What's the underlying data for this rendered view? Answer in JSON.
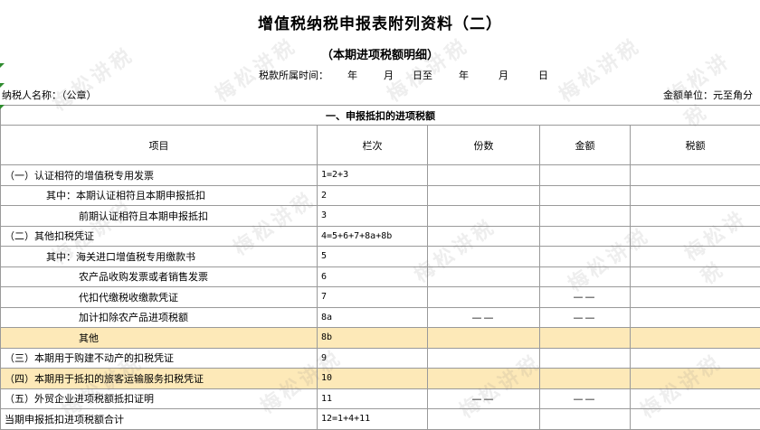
{
  "title": "增值税纳税申报表附列资料（二）",
  "subtitle": "（本期进项税额明细）",
  "period": {
    "label": "税款所属时间：",
    "year1": "年",
    "month1": "月",
    "day1_to": "日至",
    "year2": "年",
    "month2": "月",
    "day2": "日"
  },
  "taxpayer_label": "纳税人名称：（公章）",
  "unit_label": "金额单位：元至角分",
  "section_title": "一、申报抵扣的进项税额",
  "columns": {
    "item": "项目",
    "code": "栏次",
    "count": "份数",
    "amount": "金额",
    "tax": "税额"
  },
  "rows": [
    {
      "name": "（一）认证相符的增值税专用发票",
      "code": "1=2+3",
      "count": "",
      "amount": "",
      "tax": ""
    },
    {
      "name": "其中：本期认证相符且本期申报抵扣",
      "code": "2",
      "count": "",
      "amount": "",
      "tax": ""
    },
    {
      "name": "前期认证相符且本期申报抵扣",
      "code": "3",
      "count": "",
      "amount": "",
      "tax": ""
    },
    {
      "name": "（二）其他扣税凭证",
      "code": "4=5+6+7+8a+8b",
      "count": "",
      "amount": "",
      "tax": ""
    },
    {
      "name": "其中：海关进口增值税专用缴款书",
      "code": "5",
      "count": "",
      "amount": "",
      "tax": ""
    },
    {
      "name": "农产品收购发票或者销售发票",
      "code": "6",
      "count": "",
      "amount": "",
      "tax": ""
    },
    {
      "name": "代扣代缴税收缴款凭证",
      "code": "7",
      "count": "",
      "amount": "——",
      "tax": ""
    },
    {
      "name": "加计扣除农产品进项税额",
      "code": "8a",
      "count": "——",
      "amount": "——",
      "tax": ""
    },
    {
      "name": "其他",
      "code": "8b",
      "count": "",
      "amount": "",
      "tax": ""
    },
    {
      "name": "（三）本期用于购建不动产的扣税凭证",
      "code": "9",
      "count": "",
      "amount": "",
      "tax": ""
    },
    {
      "name": "（四）本期用于抵扣的旅客运输服务扣税凭证",
      "code": "10",
      "count": "",
      "amount": "",
      "tax": ""
    },
    {
      "name": "（五）外贸企业进项税额抵扣证明",
      "code": "11",
      "count": "——",
      "amount": "——",
      "tax": ""
    },
    {
      "name": "当期申报抵扣进项税额合计",
      "code": "12=1+4+11",
      "count": "",
      "amount": "",
      "tax": ""
    }
  ],
  "watermark_text": "梅松讲税",
  "highlight_color": "#fde9b8"
}
